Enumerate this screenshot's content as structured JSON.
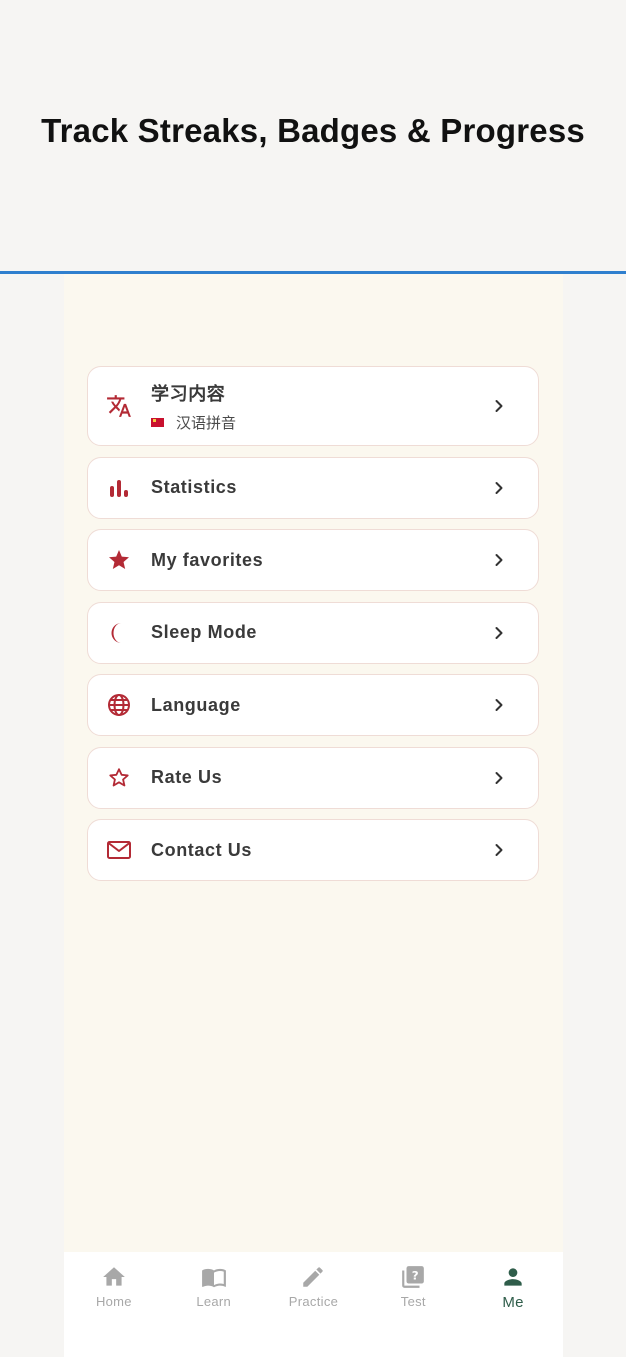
{
  "banner": {
    "title": "Track Streaks, Badges & Progress"
  },
  "menu": {
    "items": [
      {
        "label": "学习内容",
        "sub": "汉语拼音",
        "icon": "translate-icon"
      },
      {
        "label": "Statistics",
        "icon": "bar-chart-icon"
      },
      {
        "label": "My favorites",
        "icon": "star-filled-icon"
      },
      {
        "label": "Sleep Mode",
        "icon": "moon-icon"
      },
      {
        "label": "Language",
        "icon": "globe-icon"
      },
      {
        "label": "Rate Us",
        "icon": "star-outline-icon"
      },
      {
        "label": "Contact Us",
        "icon": "mail-icon"
      }
    ]
  },
  "tabs": [
    {
      "label": "Home",
      "icon": "home-icon"
    },
    {
      "label": "Learn",
      "icon": "book-icon"
    },
    {
      "label": "Practice",
      "icon": "pencil-icon"
    },
    {
      "label": "Test",
      "icon": "quiz-icon"
    },
    {
      "label": "Me",
      "icon": "person-icon",
      "active": true
    }
  ],
  "colors": {
    "accent": "#b32a35",
    "active_tab": "#2f5d4a",
    "inactive_tab": "#a8a8a8",
    "divider": "#2f7fce",
    "screen_bg": "#fbf8ef"
  }
}
